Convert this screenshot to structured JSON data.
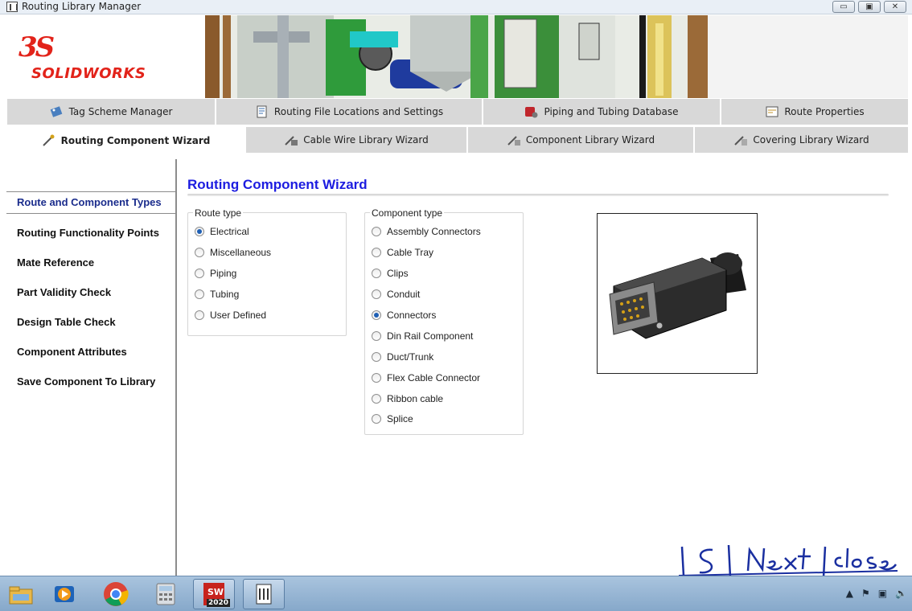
{
  "window": {
    "title": "Routing Library Manager",
    "minimize": "▭",
    "maximize": "▣",
    "close": "✕"
  },
  "brand": {
    "ds": "3S",
    "name": "SOLIDWORKS"
  },
  "tabs_row1": [
    {
      "label": "Tag Scheme Manager",
      "icon": "tag-scheme-icon"
    },
    {
      "label": "Routing File Locations and Settings",
      "icon": "file-locations-icon"
    },
    {
      "label": "Piping and Tubing Database",
      "icon": "database-icon"
    },
    {
      "label": "Route Properties",
      "icon": "route-properties-icon"
    }
  ],
  "tabs_row2": [
    {
      "label": "Routing Component Wizard",
      "icon": "component-wizard-icon",
      "active": true
    },
    {
      "label": "Cable Wire Library Wizard",
      "icon": "cable-wizard-icon"
    },
    {
      "label": "Component Library Wizard",
      "icon": "library-wizard-icon"
    },
    {
      "label": "Covering Library Wizard",
      "icon": "covering-wizard-icon"
    }
  ],
  "nav": {
    "items": [
      "Route and Component Types",
      "Routing Functionality Points",
      "Mate Reference",
      "Part Validity Check",
      "Design Table Check",
      "Component Attributes",
      "Save Component To Library"
    ],
    "active_index": 0
  },
  "main": {
    "title": "Routing Component Wizard",
    "route_type": {
      "label": "Route type",
      "options": [
        "Electrical",
        "Miscellaneous",
        "Piping",
        "Tubing",
        "User Defined"
      ],
      "selected": "Electrical"
    },
    "component_type": {
      "label": "Component type",
      "options": [
        "Assembly Connectors",
        "Cable Tray",
        "Clips",
        "Conduit",
        "Connectors",
        "Din Rail Component",
        "Duct/Trunk",
        "Flex Cable Connector",
        "Ribbon cable",
        "Splice"
      ],
      "selected": "Connectors"
    },
    "preview": "connector-preview-image"
  },
  "annotation": {
    "text": "|5| Next |close"
  },
  "taskbar": {
    "apps": [
      "file-explorer-icon",
      "media-player-icon",
      "chrome-icon",
      "calculator-icon",
      "solidworks-icon",
      "routing-library-icon"
    ],
    "sw_badge": "2020",
    "tray": [
      "▲",
      "⚑",
      "▣",
      "🔈"
    ]
  },
  "colors": {
    "title_blue": "#1c1ce0",
    "nav_active": "#1a2c8c",
    "brand_red": "#e2231a",
    "tab_bg": "#d8d8d8"
  }
}
